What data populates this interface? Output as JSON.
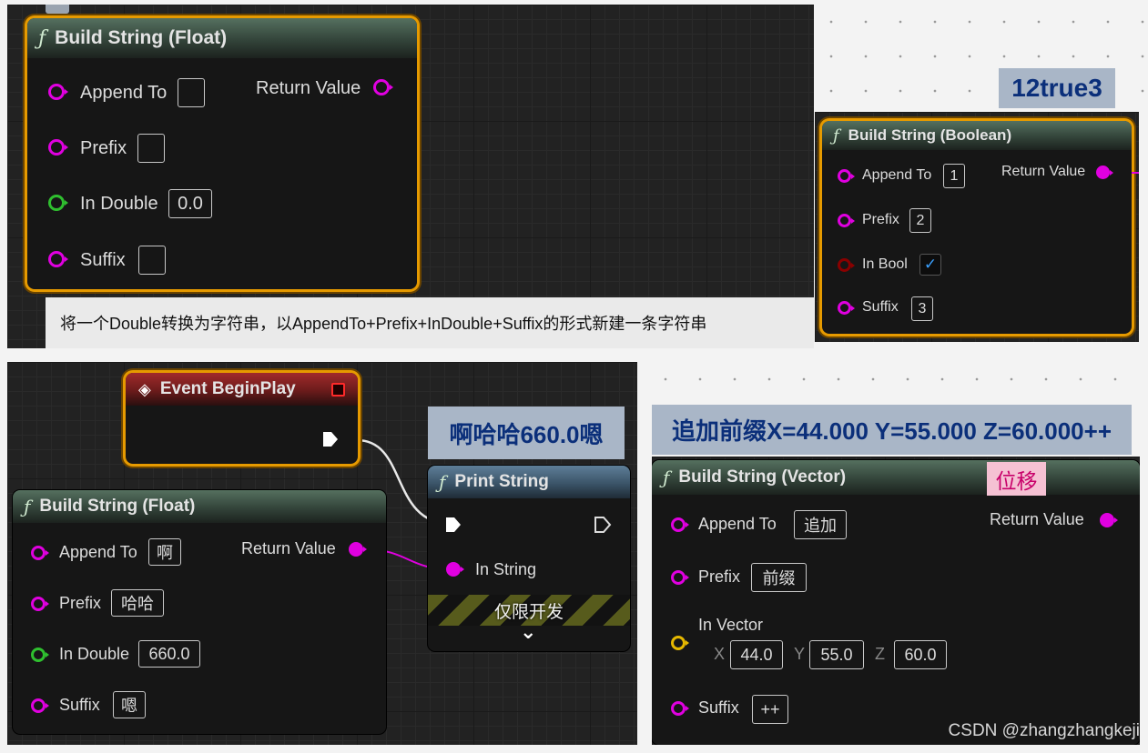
{
  "panel1": {
    "node": {
      "title": "Build String (Float)",
      "append_label": "Append To",
      "prefix_label": "Prefix",
      "in_label": "In Double",
      "in_value": "0.0",
      "suffix_label": "Suffix",
      "return_label": "Return Value"
    },
    "caption": "将一个Double转换为字符串，以AppendTo+Prefix+InDouble+Suffix的形式新建一条字符串"
  },
  "panel2": {
    "output_bubble": "12true3",
    "node": {
      "title": "Build String (Boolean)",
      "append_label": "Append To",
      "append_value": "1",
      "prefix_label": "Prefix",
      "prefix_value": "2",
      "in_label": "In Bool",
      "in_checked": "✓",
      "suffix_label": "Suffix",
      "suffix_value": "3",
      "return_label": "Return Value"
    }
  },
  "panel3": {
    "event_title": "Event BeginPlay",
    "output_bubble": "啊哈哈660.0嗯",
    "node": {
      "title": "Build String (Float)",
      "append_label": "Append To",
      "append_value": "啊",
      "prefix_label": "Prefix",
      "prefix_value": "哈哈",
      "in_label": "In Double",
      "in_value": "660.0",
      "suffix_label": "Suffix",
      "suffix_value": "嗯",
      "return_label": "Return Value"
    },
    "print": {
      "title": "Print String",
      "in_label": "In String",
      "dev_only": "仅限开发",
      "expand": "⌄"
    }
  },
  "panel4": {
    "output_bubble": "追加前缀X=44.000 Y=55.000 Z=60.000++",
    "tag": "位移",
    "node": {
      "title": "Build String (Vector)",
      "append_label": "Append To",
      "append_value": "追加",
      "prefix_label": "Prefix",
      "prefix_value": "前缀",
      "in_label": "In Vector",
      "x_label": "X",
      "x_value": "44.0",
      "y_label": "Y",
      "y_value": "55.0",
      "z_label": "Z",
      "z_value": "60.0",
      "suffix_label": "Suffix",
      "suffix_value": "++",
      "return_label": "Return Value"
    }
  },
  "watermark": "CSDN @zhangzhangkeji",
  "colors": {
    "selection": "#e69a00",
    "string_pin": "#e000e0",
    "float_pin": "#2fbf2f",
    "bool_pin": "#8a0000",
    "vector_pin": "#e6b800",
    "bubble_text": "#0b2f7a"
  }
}
